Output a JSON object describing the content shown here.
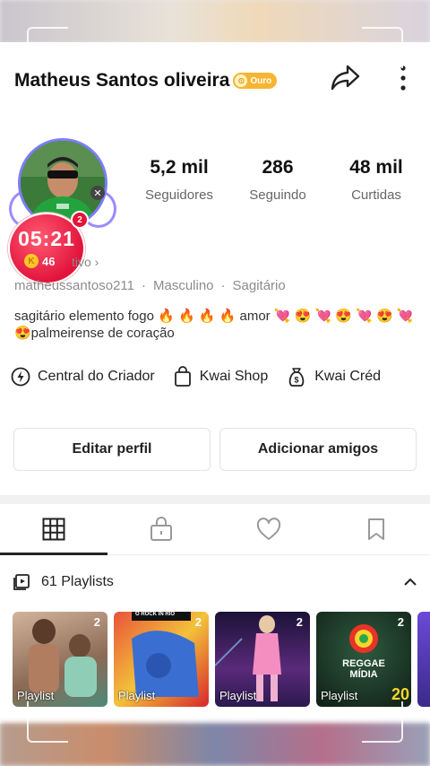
{
  "profile": {
    "name": "Matheus Santos oliveira",
    "badge": "Ouro",
    "username": "matheussantoso211",
    "gender": "Masculino",
    "sign": "Sagitário",
    "active_status": "tivo ›",
    "bio": "sagitário elemento fogo 🔥 🔥 🔥 🔥 amor 💘 😍 💘 😍 💘 😍 💘 😍palmeirense de coração"
  },
  "timer": {
    "time": "05:21",
    "coins": "46",
    "notif": "2",
    "coin_icon": "K"
  },
  "stats": [
    {
      "value": "5,2 mil",
      "label": "Seguidores"
    },
    {
      "value": "286",
      "label": "Seguindo"
    },
    {
      "value": "48 mil",
      "label": "Curtidas"
    }
  ],
  "tools": [
    {
      "label": "Central do Criador",
      "icon": "lightning-icon"
    },
    {
      "label": "Kwai Shop",
      "icon": "shopping-bag-icon"
    },
    {
      "label": "Kwai Créd",
      "icon": "money-bag-icon"
    }
  ],
  "buttons": {
    "edit": "Editar perfil",
    "add": "Adicionar amigos"
  },
  "tabs": [
    "grid-icon",
    "lock-icon",
    "heart-icon",
    "bookmark-icon"
  ],
  "playlists": {
    "label": "61 Playlists",
    "items": [
      {
        "count": "2",
        "label": "Playlist",
        "color": "#b88a74"
      },
      {
        "count": "2",
        "label": "Playlist",
        "color": "#d6452b",
        "overlay": "O ROCK IN RIO"
      },
      {
        "count": "2",
        "label": "Playlist",
        "color": "#3a2a6b"
      },
      {
        "count": "2",
        "label": "Playlist",
        "color": "#1f3a2c",
        "overlay": "REGGAE MÍDIA",
        "extra": "20"
      }
    ]
  },
  "colors": {
    "accent": "#7d7dfa",
    "timer_red": "#e2143c",
    "gold": "#f7b531"
  }
}
